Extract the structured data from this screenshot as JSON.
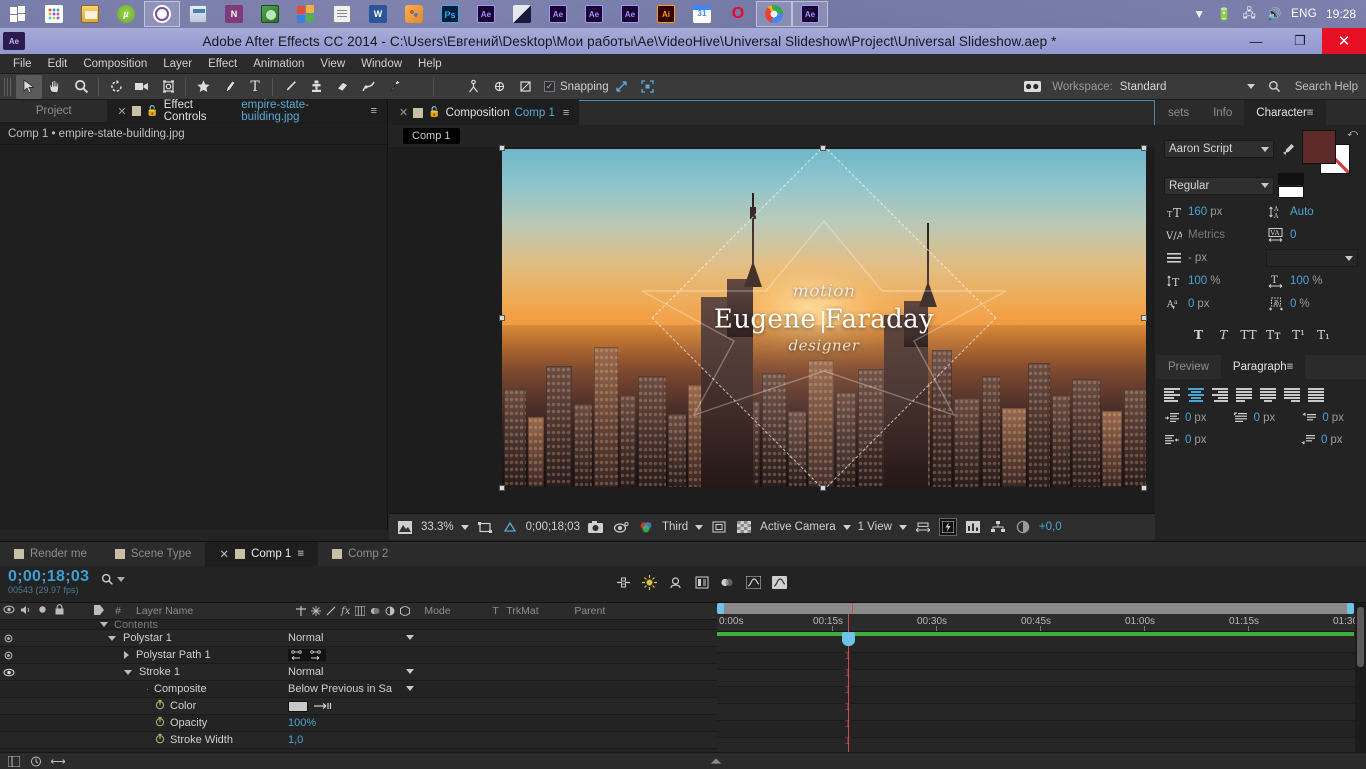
{
  "taskbar": {
    "items": [
      {
        "name": "start-button",
        "icon": "windows-icon"
      },
      {
        "name": "app-launcher",
        "icon": "grid-icon"
      },
      {
        "name": "file-explorer",
        "icon": "explorer-icon"
      },
      {
        "name": "utorrent",
        "icon": "utorrent-icon"
      },
      {
        "name": "viber",
        "icon": "viber-icon",
        "active": true
      },
      {
        "name": "calculator",
        "icon": "calculator-icon"
      },
      {
        "name": "onenote",
        "icon": "onenote-icon"
      },
      {
        "name": "app-green",
        "icon": "green-app-icon"
      },
      {
        "name": "colors-app",
        "icon": "color-squares-icon"
      },
      {
        "name": "notepad",
        "icon": "notepad-icon"
      },
      {
        "name": "word",
        "icon": "word-icon"
      },
      {
        "name": "paint",
        "icon": "paint-icon"
      },
      {
        "name": "photoshop",
        "icon": "photoshop-icon"
      },
      {
        "name": "after-effects-1",
        "icon": "after-effects-icon"
      },
      {
        "name": "gradient-app",
        "icon": "gradient-icon"
      },
      {
        "name": "after-effects-2",
        "icon": "after-effects-icon"
      },
      {
        "name": "after-effects-3",
        "icon": "after-effects-icon"
      },
      {
        "name": "after-effects-4",
        "icon": "after-effects-icon"
      },
      {
        "name": "illustrator",
        "icon": "illustrator-icon"
      },
      {
        "name": "calendar",
        "icon": "calendar-icon"
      },
      {
        "name": "opera",
        "icon": "opera-icon"
      },
      {
        "name": "chrome",
        "icon": "chrome-icon",
        "active": true
      },
      {
        "name": "after-effects-active",
        "icon": "after-effects-icon",
        "active": true
      }
    ],
    "tray_overflow": "▼",
    "language": "ENG",
    "clock": "19:28"
  },
  "window": {
    "title": "Adobe After Effects CC 2014 - C:\\Users\\Евгений\\Desktop\\Мои работы\\Ae\\VideoHive\\Universal Slideshow\\Project\\Universal Slideshow.aep *",
    "app_badge": "Ae",
    "minimize": "—",
    "maximize": "❐",
    "close": "✕"
  },
  "menubar": {
    "items": [
      "File",
      "Edit",
      "Composition",
      "Layer",
      "Effect",
      "Animation",
      "View",
      "Window",
      "Help"
    ]
  },
  "toolbar": {
    "tools": [
      {
        "name": "selection-tool",
        "selected": true
      },
      {
        "name": "hand-tool",
        "selected": false
      },
      {
        "name": "zoom-tool",
        "selected": false
      },
      {
        "name": "rotation-tool",
        "selected": false
      },
      {
        "name": "camera-tool",
        "selected": false
      },
      {
        "name": "pan-behind-tool",
        "selected": false
      },
      {
        "name": "shape-tool",
        "selected": false
      },
      {
        "name": "pen-tool",
        "selected": false
      },
      {
        "name": "type-tool",
        "selected": false
      },
      {
        "name": "brush-tool",
        "selected": false
      },
      {
        "name": "clone-stamp-tool",
        "selected": false
      },
      {
        "name": "eraser-tool",
        "selected": false
      },
      {
        "name": "roto-brush-tool",
        "selected": false
      },
      {
        "name": "puppet-pin-tool",
        "selected": false
      }
    ],
    "axis_tools": [
      {
        "name": "local-axis-mode"
      },
      {
        "name": "world-axis-mode"
      },
      {
        "name": "view-axis-mode"
      }
    ],
    "snapping_label": "Snapping",
    "snapping_checked": true,
    "workspace_label": "Workspace:",
    "workspace_value": "Standard",
    "search_help_placeholder": "Search Help"
  },
  "effect_controls": {
    "tabs": [
      {
        "label": "Project",
        "active": false,
        "closable": false
      },
      {
        "label": "Effect Controls",
        "secondary": "empire-state-building.jpg",
        "active": true,
        "closable": true
      }
    ],
    "subtitle": "Comp 1 • empire-state-building.jpg"
  },
  "composition": {
    "tab_label": "Composition",
    "tab_secondary": "Comp 1",
    "breadcrumb": "Comp 1",
    "artwork": {
      "motion_text": "motion",
      "name_text": "Eugene Faraday",
      "designer_text": "designer"
    },
    "bottombar": {
      "zoom": "33.3%",
      "time": "0;00;18;03",
      "resolution": "Third",
      "view": "Active Camera",
      "views": "1 View",
      "offset": "+0,0"
    }
  },
  "right_panels": {
    "tabs": [
      {
        "label": "sets",
        "active": false
      },
      {
        "label": "Info",
        "active": false
      },
      {
        "label": "Character",
        "active": true
      }
    ],
    "character": {
      "font_family": "Aaron Script",
      "font_style": "Regular",
      "font_size": "160",
      "font_size_unit": "px",
      "leading": "Auto",
      "kerning": "Metrics",
      "tracking": "0",
      "stroke_width": "-",
      "stroke_width_unit": "px",
      "vertical_scale": "100",
      "vertical_scale_unit": "%",
      "horizontal_scale": "100",
      "horizontal_scale_unit": "%",
      "baseline_shift": "0",
      "baseline_shift_unit": "px",
      "tsume": "0",
      "tsume_unit": "%",
      "fill_color": "#5e2a2a",
      "stroke_color": "#ffffff",
      "type_buttons": [
        "T",
        "T",
        "TT",
        "Tт",
        "T¹",
        "T₁"
      ]
    },
    "paragraph": {
      "tabs": [
        {
          "label": "Preview",
          "active": false
        },
        {
          "label": "Paragraph",
          "active": true
        }
      ],
      "align_buttons": [
        "align-left",
        "align-center",
        "align-right",
        "justify-last-left",
        "justify-last-center",
        "justify-last-right",
        "justify-all"
      ],
      "active_align": 1,
      "indents": [
        {
          "name": "indent-left",
          "value": "0",
          "unit": "px"
        },
        {
          "name": "indent-first-line",
          "value": "0",
          "unit": "px"
        },
        {
          "name": "space-before",
          "value": "0",
          "unit": "px"
        },
        {
          "name": "indent-right",
          "value": "0",
          "unit": "px"
        },
        {
          "name": "space-after",
          "value": "0",
          "unit": "px"
        }
      ]
    }
  },
  "timeline": {
    "tabs": [
      {
        "label": "Render me",
        "active": false
      },
      {
        "label": "Scene Type",
        "active": false
      },
      {
        "label": "Comp 1",
        "active": true,
        "closable": true
      },
      {
        "label": "Comp 2",
        "active": false
      }
    ],
    "current_time": "0;00;18;03",
    "frame_info": "00543 (29.97 fps)",
    "columns": [
      "Layer Name",
      "Mode",
      "T",
      "TrkMat",
      "Parent"
    ],
    "column_toggles": [
      "video-eye",
      "audio",
      "solo",
      "lock"
    ],
    "rows": [
      {
        "name": "Contents",
        "indent": 3,
        "value": "",
        "mode": "",
        "expanded": true,
        "eye": false,
        "dim": true
      },
      {
        "name": "Polystar 1",
        "indent": 3,
        "mode": "Normal",
        "value": "",
        "expanded": true,
        "eye": true
      },
      {
        "name": "Polystar Path 1",
        "indent": 4,
        "mode": "",
        "value": "",
        "expanded": false,
        "eye": true
      },
      {
        "name": "Stroke 1",
        "indent": 4,
        "mode": "Normal",
        "value": "",
        "expanded": true,
        "eye": true
      },
      {
        "name": "Composite",
        "indent": 5,
        "mode": "Below Previous in Sa",
        "value": "",
        "eye": false
      },
      {
        "name": "Color",
        "indent": 5,
        "mode": "",
        "value": "",
        "eye": false,
        "stopwatch": true,
        "swatch": "#c8c8c8"
      },
      {
        "name": "Opacity",
        "indent": 5,
        "mode": "",
        "value": "100%",
        "eye": false,
        "stopwatch": true
      },
      {
        "name": "Stroke Width",
        "indent": 5,
        "mode": "",
        "value": "1,0",
        "eye": false,
        "stopwatch": true
      }
    ],
    "ruler_ticks": [
      "0:00s",
      "00:15s",
      "00:30s",
      "00:45s",
      "01:00s",
      "01:15s",
      "01:30"
    ]
  }
}
